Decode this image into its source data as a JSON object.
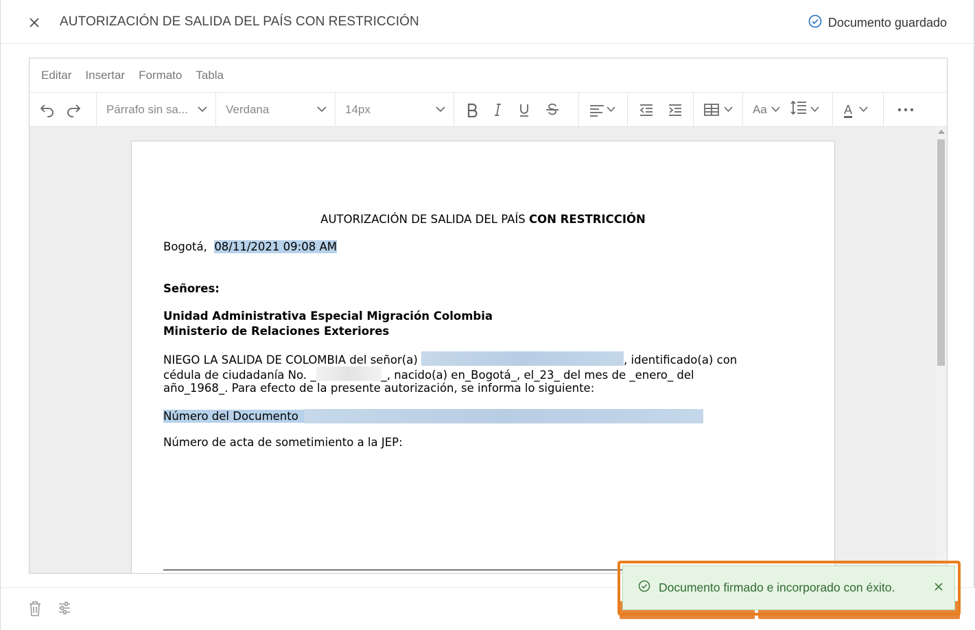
{
  "header": {
    "title": "AUTORIZACIÓN DE SALIDA DEL PAÍS CON RESTRICCIÓN",
    "saved_status": "Documento guardado"
  },
  "menubar": {
    "items": [
      "Editar",
      "Insertar",
      "Formato",
      "Tabla"
    ]
  },
  "toolbar": {
    "paragraph_style": "Párrafo sin sa...",
    "font_family": "Verdana",
    "font_size": "14px",
    "case_label": "Aa",
    "text_color_label": "A"
  },
  "document": {
    "title_normal": "AUTORIZACIÓN DE SALIDA DEL PAÍS ",
    "title_bold": "CON RESTRICCIÓN",
    "city": "Bogotá,",
    "datetime": "08/11/2021 09:08 AM",
    "salutation": "Señores:",
    "addressee_1": "Unidad Administrativa Especial Migración Colombia",
    "addressee_2": "Ministerio de Relaciones Exteriores",
    "body_1a": "NIEGO LA SALIDA DE COLOMBIA del señor(a) ",
    "body_1b": ", identificado(a) con",
    "body_2a": "cédula de ciudadanía No. _",
    "body_2b": "_, nacido(a) en_Bogotá_, el_23_ del mes de _enero_ del",
    "body_3": "año_1968_. Para efecto de la presente autorización, se informa lo siguiente:",
    "doc_number_label": "Número del Documento",
    "act_number_label": "Número de acta de sometimiento a la JEP:"
  },
  "toast": {
    "message": "Documento firmado e incorporado con éxito."
  },
  "colors": {
    "accent": "#1f6fbf",
    "toast_bg": "#e6f4e4",
    "toast_text": "#2f6b2f",
    "highlight": "#b7d1ea",
    "toast_outline": "#e87e1e"
  }
}
